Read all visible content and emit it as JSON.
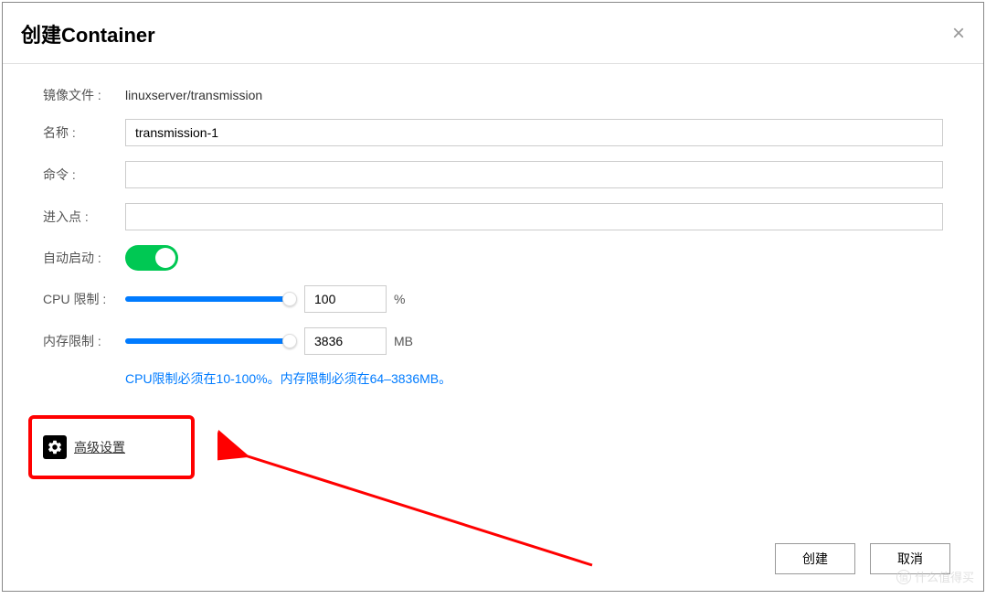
{
  "dialog": {
    "title": "创建Container",
    "close_symbol": "×"
  },
  "form": {
    "image_file": {
      "label": "镜像文件 :",
      "value": "linuxserver/transmission"
    },
    "name": {
      "label": "名称 :",
      "value": "transmission-1"
    },
    "command": {
      "label": "命令 :",
      "value": ""
    },
    "entrypoint": {
      "label": "进入点 :",
      "value": ""
    },
    "auto_start": {
      "label": "自动启动 :",
      "enabled": true
    },
    "cpu_limit": {
      "label": "CPU 限制 :",
      "value": "100",
      "unit": "%"
    },
    "memory_limit": {
      "label": "内存限制 :",
      "value": "3836",
      "unit": "MB"
    },
    "hint": "CPU限制必须在10-100%。内存限制必须在64–3836MB。",
    "advanced_settings": {
      "label": "高级设置"
    }
  },
  "footer": {
    "create_label": "创建",
    "cancel_label": "取消"
  },
  "watermark": {
    "text": "什么值得买",
    "icon": "值"
  }
}
